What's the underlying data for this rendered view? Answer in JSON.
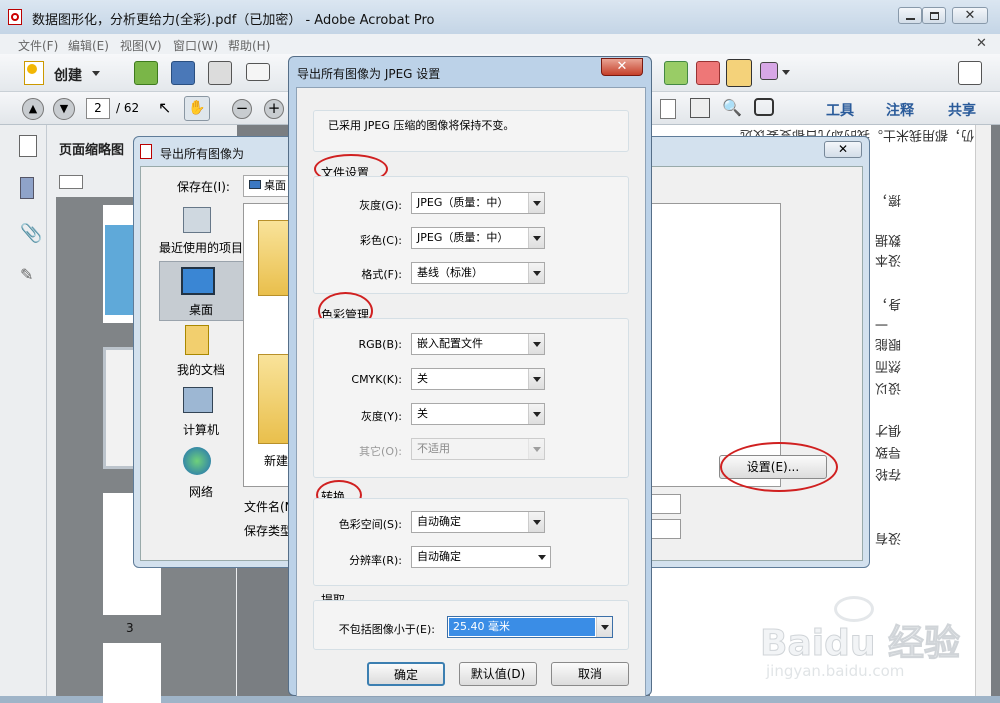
{
  "app": {
    "title": "数据图形化，分析更给力(全彩).pdf（已加密） - Adobe Acrobat Pro",
    "menus": [
      "文件(F)",
      "编辑(E)",
      "视图(V)",
      "窗口(W)",
      "帮助(H)"
    ],
    "create_label": "创建",
    "page_current": "2",
    "page_total": "/ 62",
    "tools_tab": "工具",
    "comment_tab": "注释",
    "share_tab": "共享",
    "thumbnails_title": "页面缩略图",
    "thumb_page_number": "3"
  },
  "export_dialog": {
    "title": "导出所有图像为",
    "save_in_label": "保存在(I):",
    "save_in_value": "桌面",
    "places": [
      "最近使用的项目",
      "桌面",
      "我的文档",
      "计算机",
      "网络"
    ],
    "folder_label": "新建",
    "filename_label": "文件名(N):",
    "filetype_label": "保存类型(T):",
    "settings_button": "设置(E)..."
  },
  "jpeg_dialog": {
    "title": "导出所有图像为 JPEG 设置",
    "note": "已采用 JPEG 压缩的图像将保持不变。",
    "file_settings": {
      "legend": "文件设置",
      "grayscale_label": "灰度(G):",
      "grayscale_value": "JPEG（质量：中）",
      "color_label": "彩色(C):",
      "color_value": "JPEG（质量：中）",
      "format_label": "格式(F):",
      "format_value": "基线（标准）"
    },
    "color_management": {
      "legend": "色彩管理",
      "rgb_label": "RGB(B):",
      "rgb_value": "嵌入配置文件",
      "cmyk_label": "CMYK(K):",
      "cmyk_value": "关",
      "gray_label": "灰度(Y):",
      "gray_value": "关",
      "other_label": "其它(O):",
      "other_value": "不适用"
    },
    "conversion": {
      "legend": "转换",
      "colorspace_label": "色彩空间(S):",
      "colorspace_value": "自动确定",
      "resolution_label": "分辨率(R):",
      "resolution_value": "自动确定"
    },
    "extract": {
      "legend": "提取",
      "exclude_label": "不包括图像小于(E):",
      "exclude_value": "25.40 毫米"
    },
    "ok_button": "确定",
    "defaults_button": "默认值(D)",
    "cancel_button": "取消"
  },
  "doc_text": [
    "仍，都用我米士。我的却几日都变要议选",
    "擦，",
    "数据",
    "没本",
    "身，",
    "一",
    "眼能",
    "然而",
    "设以",
    "俱才",
    "导致",
    "存轮",
    "没有"
  ],
  "watermark": {
    "brand": "Baidu 经验",
    "url": "jingyan.baidu.com"
  }
}
